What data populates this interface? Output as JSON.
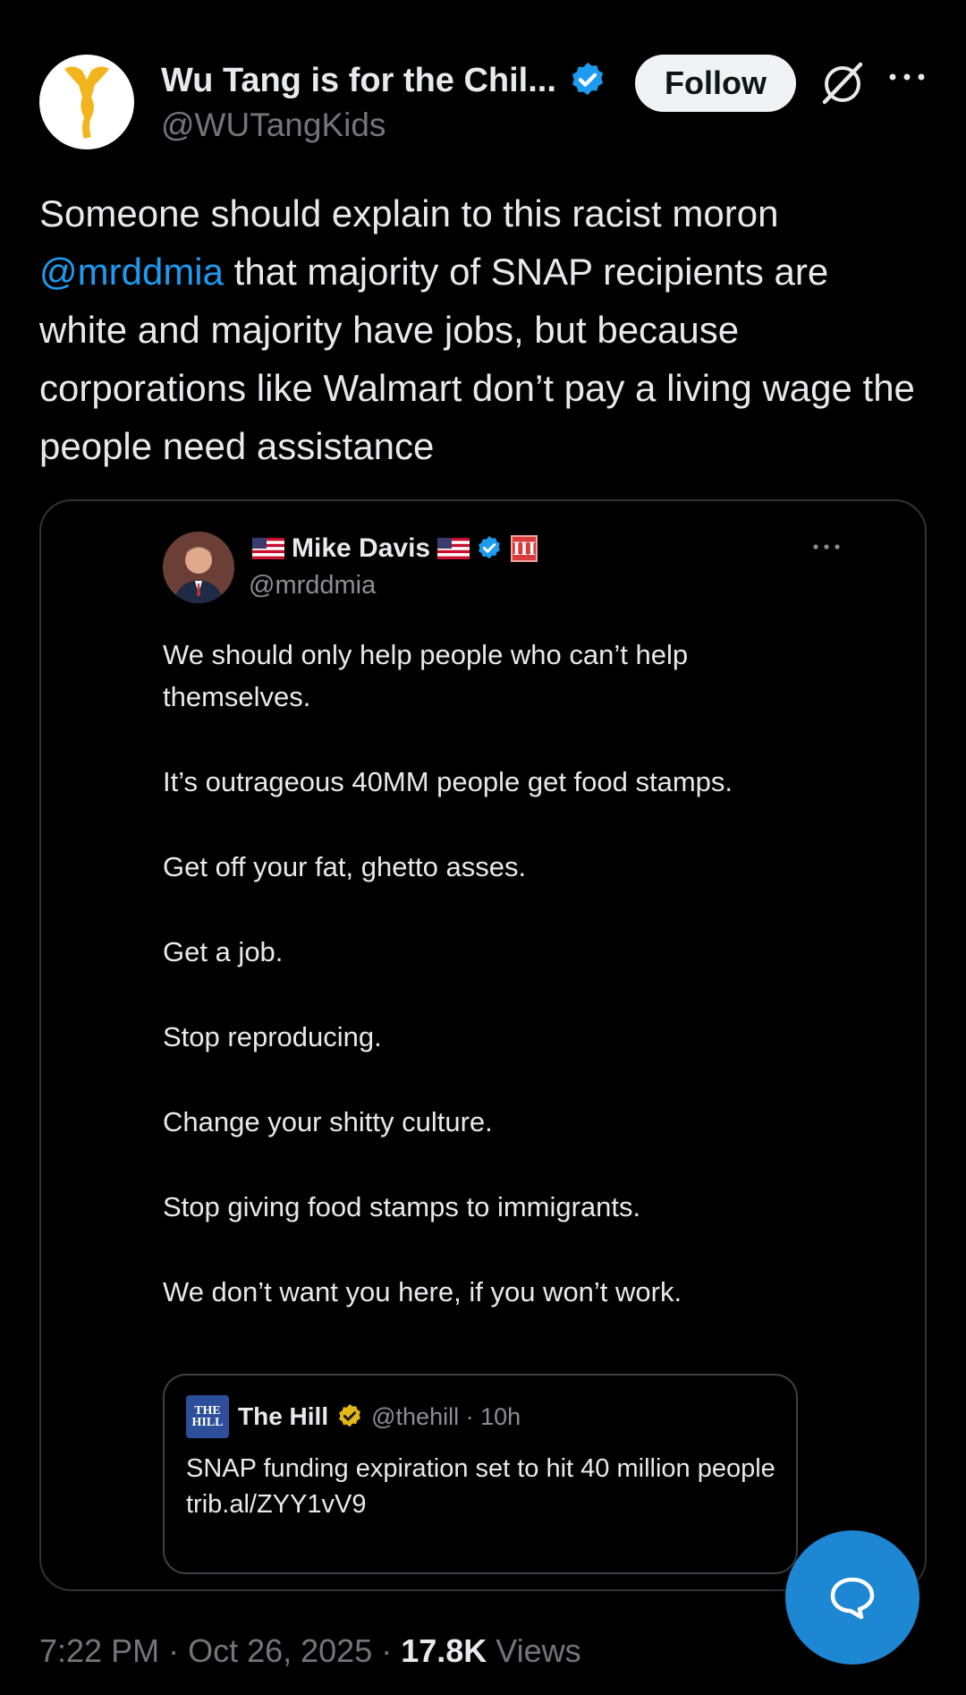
{
  "author": {
    "display_name": "Wu Tang is for the Chil...",
    "handle": "@WUTangKids",
    "follow_label": "Follow"
  },
  "tweet": {
    "text_before": "Someone should explain to this racist moron ",
    "mention": "@mrddmia",
    "text_after": " that majority of SNAP recipients are white and majority have jobs, but because corporations like Walmart don’t pay a living wage the people need assistance"
  },
  "quote": {
    "display_name": "Mike Davis",
    "handle": "@mrddmia",
    "roman_badge": "III",
    "paragraphs": [
      "We should only help people who can’t help themselves.",
      "It’s outrageous 40MM people get food stamps.",
      "Get off your fat, ghetto asses.",
      "Get a job.",
      "Stop reproducing.",
      "Change your shitty culture.",
      "Stop giving food stamps to immigrants.",
      "We don’t want you here, if you won’t work."
    ],
    "nested": {
      "logo_text_top": "THE",
      "logo_text_bottom": "HILL",
      "display_name": "The Hill",
      "meta": "@thehill · 10h",
      "line1": "SNAP funding expiration set to hit 40 million people",
      "link": "trib.al/ZYY1vV9"
    }
  },
  "footer": {
    "time": "7:22 PM",
    "date": "Oct 26, 2025",
    "views_count": "17.8K",
    "views_label": "Views"
  },
  "colors": {
    "accent": "#1d9bf0",
    "background": "#000000",
    "fab": "#1d87d4"
  }
}
